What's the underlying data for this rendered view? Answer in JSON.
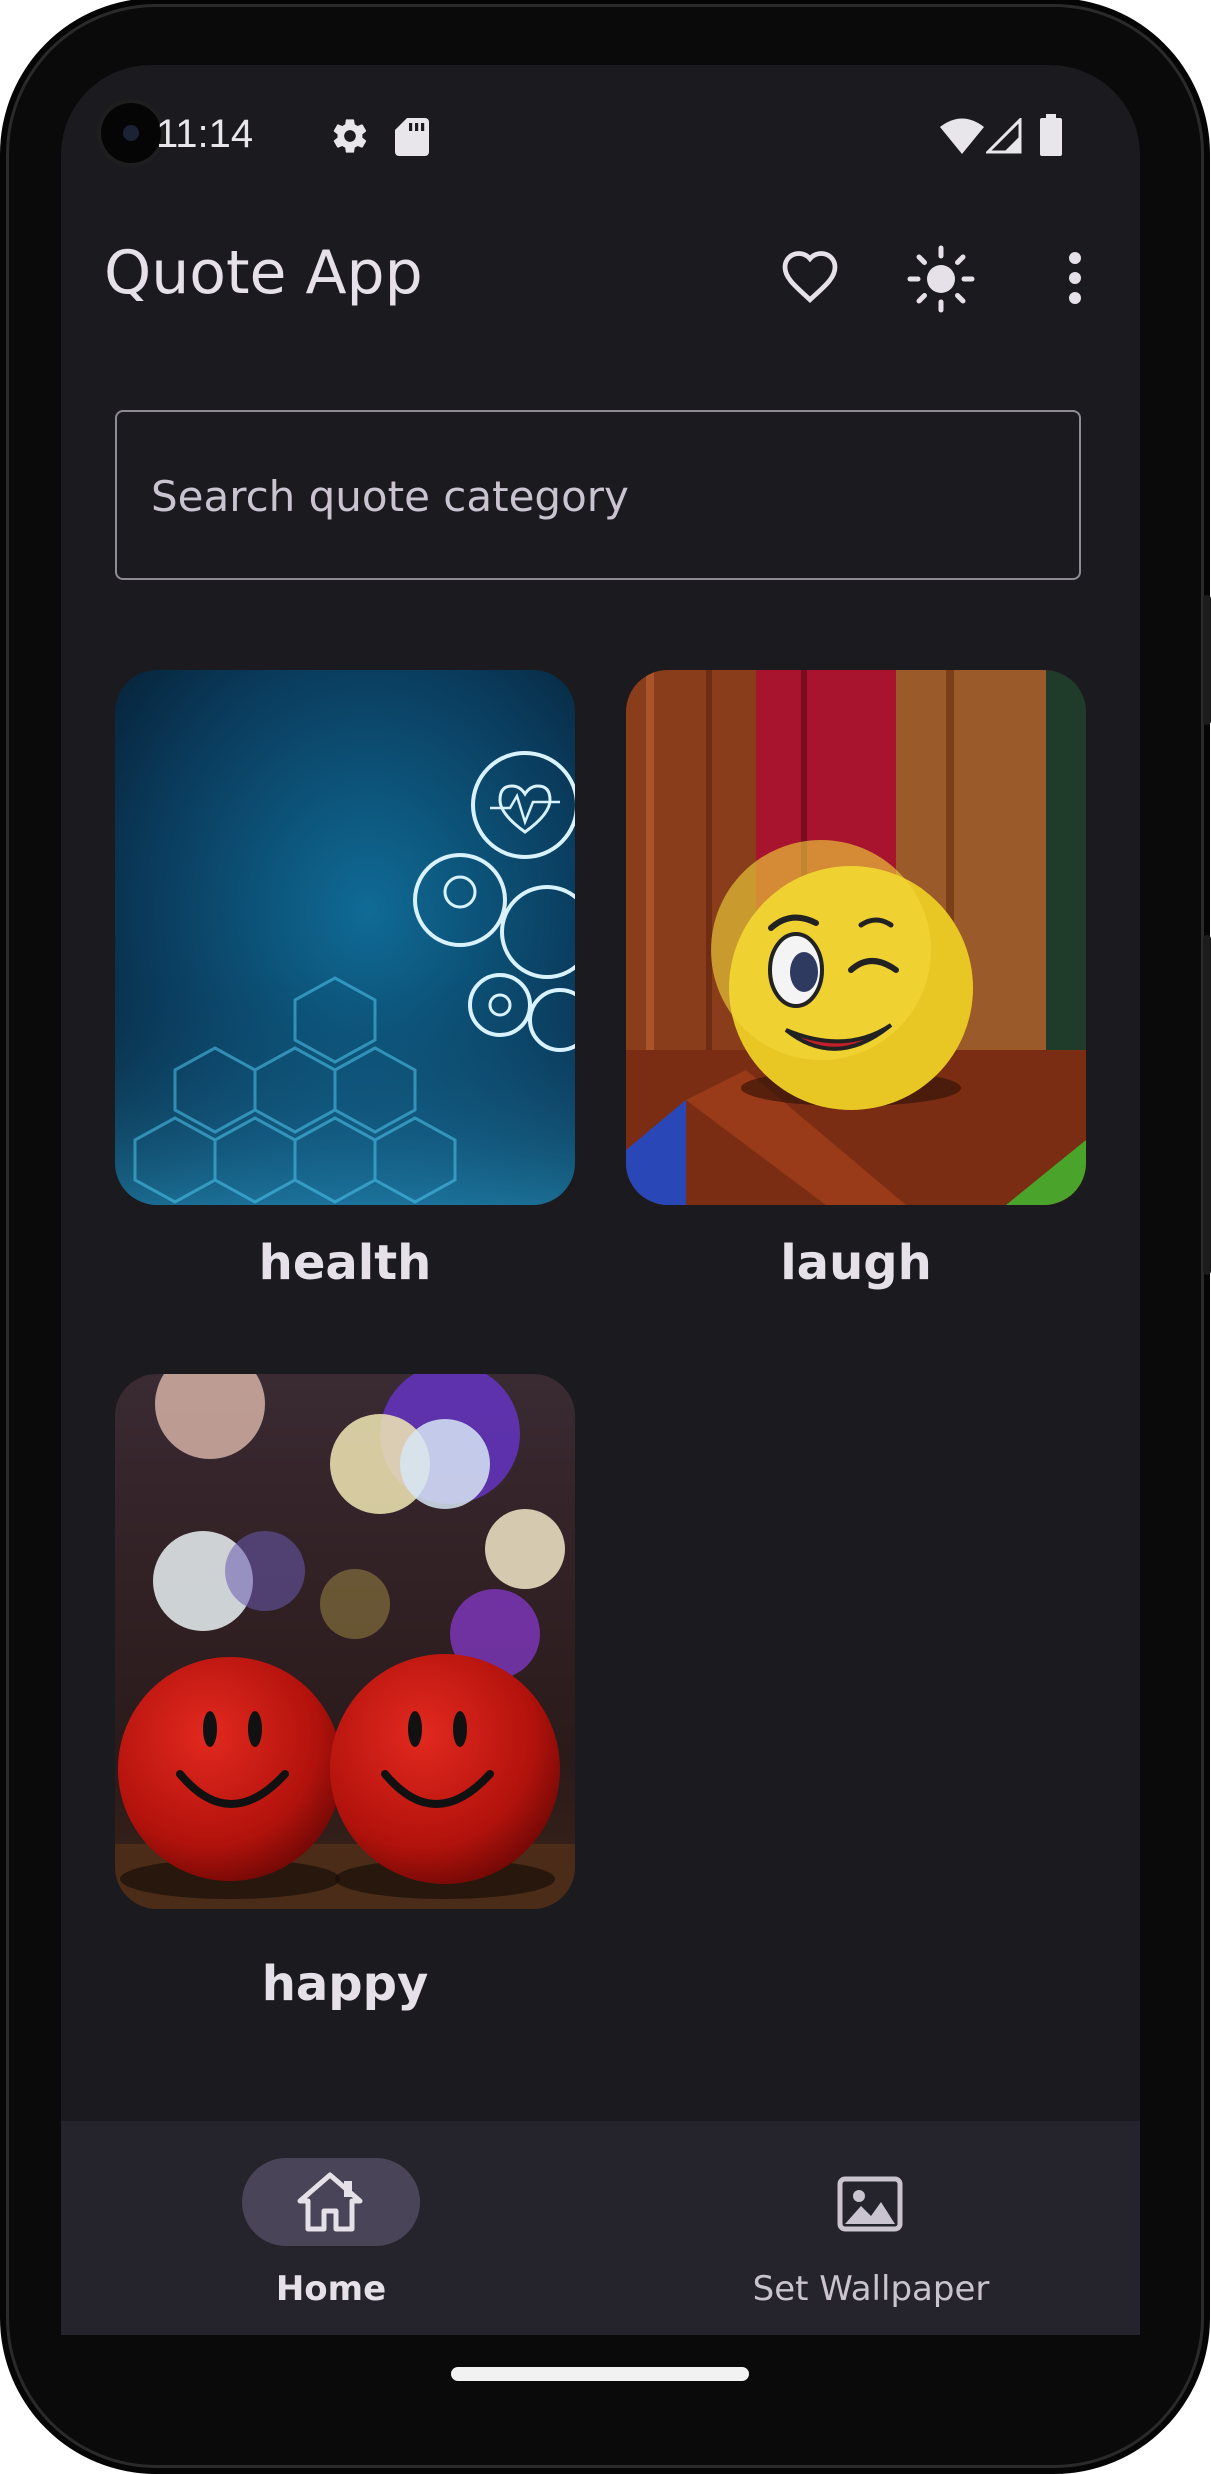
{
  "status_bar": {
    "time": "11:14"
  },
  "app_bar": {
    "title": "Quote App",
    "icons": [
      "heart-icon",
      "brightness-icon",
      "more-vert-icon"
    ]
  },
  "search": {
    "placeholder": "Search quote category",
    "value": ""
  },
  "categories": [
    {
      "label": "health",
      "image": "health-technology-image"
    },
    {
      "label": "laugh",
      "image": "winking-smiley-ball-image"
    },
    {
      "label": "happy",
      "image": "red-smiley-balls-image"
    }
  ],
  "bottom_nav": {
    "items": [
      {
        "label": "Home",
        "icon": "home-icon",
        "selected": true
      },
      {
        "label": "Set Wallpaper",
        "icon": "image-icon",
        "selected": false
      }
    ]
  },
  "colors": {
    "background": "#1b1a1f",
    "nav_background": "#25232b",
    "nav_indicator": "#4a4458",
    "text": "#e6e1e9"
  }
}
